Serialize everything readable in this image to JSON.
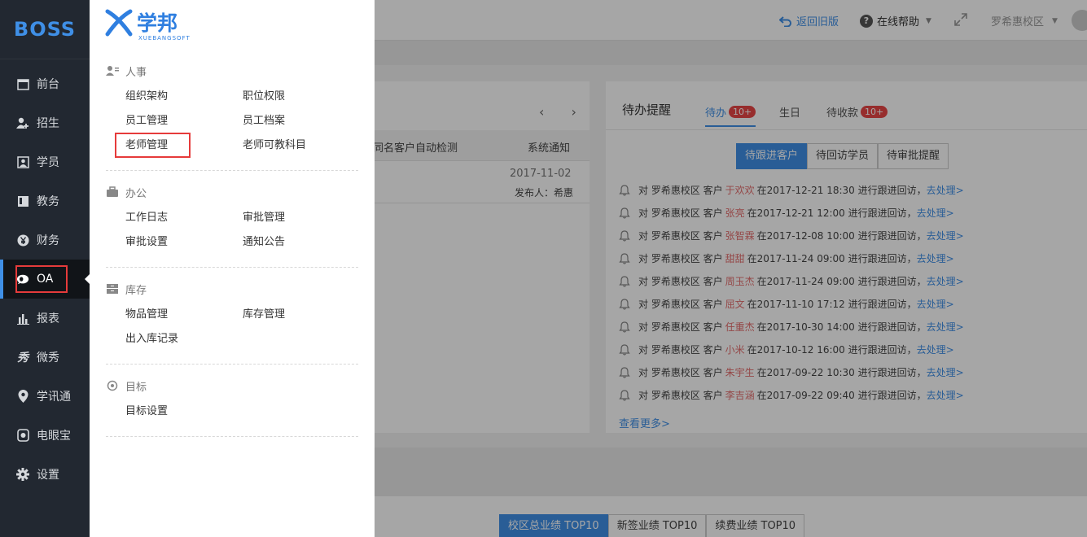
{
  "sidebar": {
    "logo": "BOSS",
    "items": [
      {
        "label": "前台",
        "icon": "calendar-icon"
      },
      {
        "label": "招生",
        "icon": "user-add-icon"
      },
      {
        "label": "学员",
        "icon": "student-card-icon"
      },
      {
        "label": "教务",
        "icon": "book-icon"
      },
      {
        "label": "财务",
        "icon": "yen-icon"
      },
      {
        "label": "OA",
        "icon": "chat-bubble-icon"
      },
      {
        "label": "报表",
        "icon": "bar-chart-icon"
      },
      {
        "label": "微秀",
        "icon": "xiu-icon"
      },
      {
        "label": "学讯通",
        "icon": "location-pin-icon"
      },
      {
        "label": "电眼宝",
        "icon": "camera-icon"
      },
      {
        "label": "设置",
        "icon": "gear-icon"
      }
    ]
  },
  "flyout": {
    "brand": "学邦",
    "brand_sub": "XUEBANGSOFT",
    "sections": [
      {
        "title": "人事",
        "links": [
          "组织架构",
          "职位权限",
          "员工管理",
          "员工档案",
          "老师管理",
          "老师可教科目"
        ]
      },
      {
        "title": "办公",
        "links": [
          "工作日志",
          "审批管理",
          "审批设置",
          "通知公告"
        ]
      },
      {
        "title": "库存",
        "links": [
          "物品管理",
          "库存管理",
          "出入库记录"
        ]
      },
      {
        "title": "目标",
        "links": [
          "目标设置"
        ]
      }
    ]
  },
  "topbar": {
    "back_label": "返回旧版",
    "help_label": "在线帮助",
    "campus": "罗希惠校区"
  },
  "notice": {
    "title_fragment": "同名客户自动检测",
    "type": "系统通知",
    "date": "2017-11-02",
    "publisher": "发布人：希惠"
  },
  "todo": {
    "title": "待办提醒",
    "tabs": [
      {
        "label": "待办",
        "badge": "10+"
      },
      {
        "label": "生日",
        "badge": ""
      },
      {
        "label": "待收款",
        "badge": "10+"
      }
    ],
    "segments": [
      "待跟进客户",
      "待回访学员",
      "待审批提醒"
    ],
    "prefix": "对 罗希惠校区 客户",
    "action_text": "进行跟进回访，",
    "action_link": "去处理>",
    "items": [
      {
        "name": "于欢欢",
        "time": "2017-12-21 18:30"
      },
      {
        "name": "张亮",
        "time": "2017-12-21 12:00"
      },
      {
        "name": "张智霖",
        "time": "2017-12-08 10:00"
      },
      {
        "name": "甜甜",
        "time": "2017-11-24 09:00"
      },
      {
        "name": "周玉杰",
        "time": "2017-11-24 09:00"
      },
      {
        "name": "屈文",
        "time": "2017-11-10 17:12"
      },
      {
        "name": "任重杰",
        "time": "2017-10-30 14:00"
      },
      {
        "name": "小米",
        "time": "2017-10-12 16:00"
      },
      {
        "name": "朱宇生",
        "time": "2017-09-22 10:30"
      },
      {
        "name": "李吉涵",
        "time": "2017-09-22 09:40"
      }
    ],
    "more": "查看更多>"
  },
  "performance": {
    "tabs": [
      "校区总业绩 TOP10",
      "新签业绩 TOP10",
      "续费业绩 TOP10"
    ]
  },
  "colors": {
    "accent": "#3f8fe6",
    "highlight": "#e63b3b",
    "sidebar_bg": "#222831"
  }
}
